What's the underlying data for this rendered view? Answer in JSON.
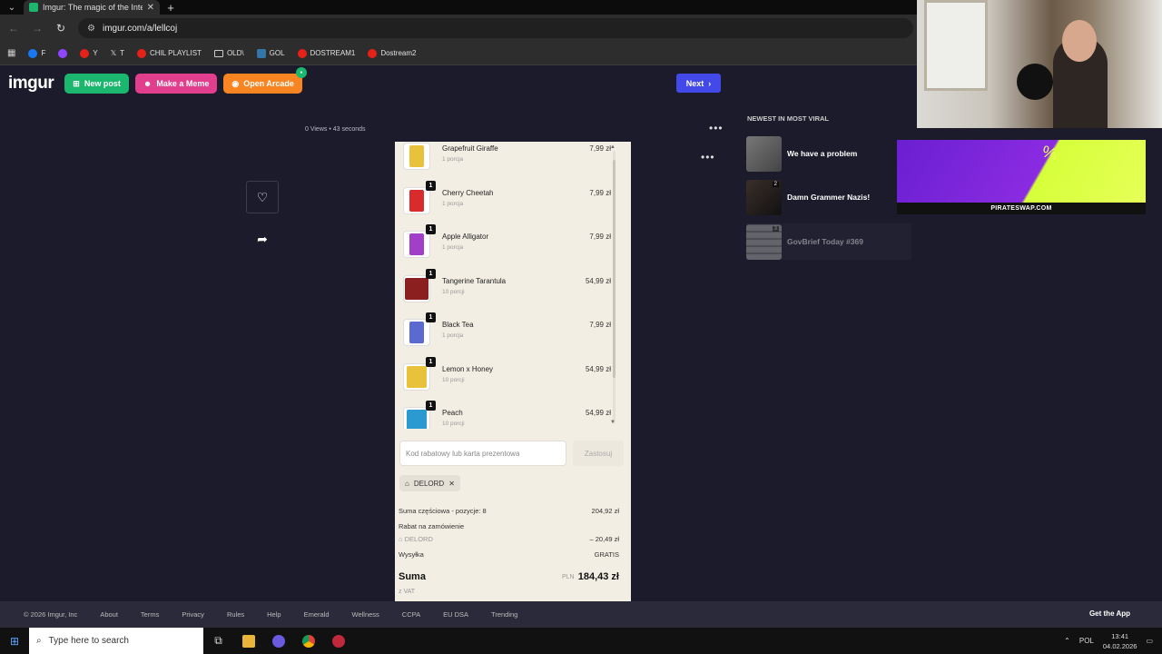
{
  "browser": {
    "tab_title": "Imgur: The magic of the Interne",
    "url": "imgur.com/a/lellcoj",
    "bookmarks": [
      {
        "label": "F",
        "icon": "facebook-icon",
        "color": "blue"
      },
      {
        "label": "",
        "icon": "twitch-icon",
        "color": "purple"
      },
      {
        "label": "Y",
        "icon": "youtube-icon",
        "color": "red"
      },
      {
        "label": "T",
        "icon": "x-icon",
        "color": ""
      },
      {
        "label": "CHIL PLAYLIST",
        "icon": "youtube-icon",
        "color": "red"
      },
      {
        "label": "OLD\\",
        "icon": "folder-icon",
        "color": "folder"
      },
      {
        "label": "GOL",
        "icon": "gol-icon",
        "color": "teal"
      },
      {
        "label": "DOSTREAM1",
        "icon": "youtube-icon",
        "color": "red"
      },
      {
        "label": "Dostream2",
        "icon": "youtube-icon",
        "color": "red"
      }
    ]
  },
  "header": {
    "logo": "imgur",
    "new_post": "New post",
    "make_meme": "Make a Meme",
    "open_arcade": "Open Arcade",
    "next": "Next"
  },
  "post": {
    "meta": "0 Views • 43 seconds"
  },
  "cart": {
    "items": [
      {
        "name": "Grapefruit Giraffe",
        "sub": "1 porcja",
        "price": "7,99 zł",
        "qty": "",
        "color": "#e8c23a"
      },
      {
        "name": "Cherry Cheetah",
        "sub": "1 porcja",
        "price": "7,99 zł",
        "qty": "1",
        "color": "#d92b2b"
      },
      {
        "name": "Apple Alligator",
        "sub": "1 porcja",
        "price": "7,99 zł",
        "qty": "1",
        "color": "#a23ec8"
      },
      {
        "name": "Tangerine Tarantula",
        "sub": "10 porcji",
        "price": "54,99 zł",
        "qty": "1",
        "color": "#8b1e1e"
      },
      {
        "name": "Black Tea",
        "sub": "1 porcja",
        "price": "7,99 zł",
        "qty": "1",
        "color": "#5a6ad0"
      },
      {
        "name": "Lemon x Honey",
        "sub": "10 porcji",
        "price": "54,99 zł",
        "qty": "1",
        "color": "#e8c23a"
      },
      {
        "name": "Peach",
        "sub": "10 porcji",
        "price": "54,99 zł",
        "qty": "1",
        "color": "#2a9ad0"
      }
    ],
    "discount_placeholder": "Kod rabatowy lub karta prezentowa",
    "apply": "Zastosuj",
    "code": "DELORD",
    "subtotal_label": "Suma częściowa - pozycje: 8",
    "subtotal_value": "204,92 zł",
    "order_discount_label": "Rabat na zamówienie",
    "discount_code": "DELORD",
    "discount_value": "– 20,49 zł",
    "shipping_label": "Wysyłka",
    "shipping_value": "GRATIS",
    "total_label": "Suma",
    "currency": "PLN",
    "total_value": "184,43 zł",
    "vat": "z VAT"
  },
  "sidebar": {
    "title": "NEWEST IN MOST VIRAL",
    "posts": [
      {
        "title": "We have a problem",
        "count": ""
      },
      {
        "title": "Damn Grammer Nazis!",
        "count": "2"
      },
      {
        "title": "GovBrief Today #369",
        "count": "3"
      }
    ]
  },
  "ad": {
    "text": "PIRATESWAP.COM"
  },
  "footer": {
    "links": [
      "© 2026 Imgur, Inc",
      "About",
      "Terms",
      "Privacy",
      "Rules",
      "Help",
      "Emerald",
      "Wellness",
      "CCPA",
      "EU DSA",
      "Trending"
    ],
    "get_app": "Get the App"
  },
  "taskbar": {
    "search_placeholder": "Type here to search",
    "lang": "POL",
    "time": "13:41",
    "date": "04.02.2026"
  }
}
